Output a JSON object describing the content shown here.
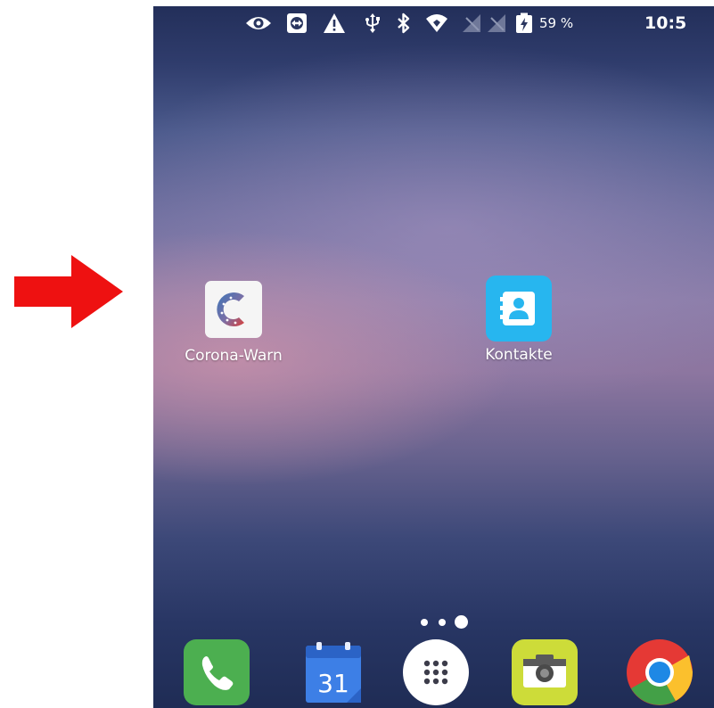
{
  "status_bar": {
    "battery_percent": "59 %",
    "time": "10:5",
    "icons": [
      "eye-icon",
      "remote-control-icon",
      "warning-icon",
      "usb-icon",
      "bluetooth-icon",
      "wifi-icon",
      "no-signal-icon",
      "no-signal-icon",
      "battery-charging-icon"
    ]
  },
  "home_apps": [
    {
      "label": "Corona-Warn",
      "icon": "corona-warn-app-icon"
    },
    {
      "label": "Kontakte",
      "icon": "contacts-icon"
    }
  ],
  "page_indicator": {
    "pages": 3,
    "active_page": 3
  },
  "dock": {
    "items": [
      {
        "icon": "phone-icon",
        "color": "#4caf50"
      },
      {
        "icon": "calendar-icon",
        "label": "31",
        "color": "#3d7fe6"
      },
      {
        "icon": "app-drawer-icon",
        "color": "#ffffff"
      },
      {
        "icon": "camera-icon",
        "color": "#cddc39"
      },
      {
        "icon": "chrome-icon",
        "color": "#e53935"
      }
    ]
  },
  "annotation": {
    "arrow_color": "#ee1111",
    "icon": "red-arrow-icon"
  }
}
